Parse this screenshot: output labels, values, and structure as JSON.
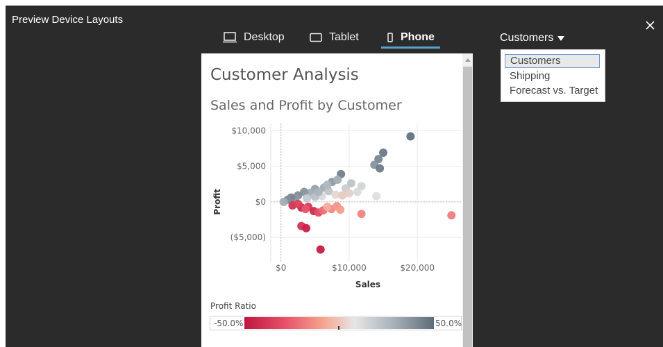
{
  "window": {
    "title": "Preview Device Layouts"
  },
  "device_tabs": [
    {
      "label": "Desktop",
      "icon": "monitor-icon",
      "active": false
    },
    {
      "label": "Tablet",
      "icon": "tablet-icon",
      "active": false
    },
    {
      "label": "Phone",
      "icon": "phone-icon",
      "active": true
    }
  ],
  "dashboard_selector": {
    "selected": "Customers",
    "options": [
      "Customers",
      "Shipping",
      "Forecast vs. Target"
    ]
  },
  "dashboard": {
    "title": "Customer Analysis",
    "subtitle": "Sales and Profit by Customer"
  },
  "legend": {
    "title": "Profit Ratio",
    "min": "-50.0%",
    "max": "50.0%"
  },
  "colors": {
    "accent": "#5aa0d0",
    "negative": "#c0163f",
    "positive": "#5d6c7a"
  },
  "chart_data": {
    "type": "scatter",
    "xlabel": "Sales",
    "ylabel": "Profit",
    "xlim": [
      -1500,
      26500
    ],
    "ylim": [
      -8500,
      11000
    ],
    "x_ticks": [
      {
        "v": 0,
        "label": "$0"
      },
      {
        "v": 10000,
        "label": "$10,000"
      },
      {
        "v": 20000,
        "label": "$20,000"
      }
    ],
    "y_ticks": [
      {
        "v": 10000,
        "label": "$10,000"
      },
      {
        "v": 5000,
        "label": "$5,000"
      },
      {
        "v": 0,
        "label": "$0"
      },
      {
        "v": -5000,
        "label": "($5,000)"
      }
    ],
    "grid": true,
    "points": [
      {
        "x": 19000,
        "y": 9200,
        "ratio": 0.48
      },
      {
        "x": 15000,
        "y": 6900,
        "ratio": 0.46
      },
      {
        "x": 14300,
        "y": 6000,
        "ratio": 0.42
      },
      {
        "x": 13700,
        "y": 5200,
        "ratio": 0.38
      },
      {
        "x": 14500,
        "y": 4700,
        "ratio": 0.45
      },
      {
        "x": 8800,
        "y": 3900,
        "ratio": 0.44
      },
      {
        "x": 7500,
        "y": 2800,
        "ratio": 0.36
      },
      {
        "x": 8300,
        "y": 3100,
        "ratio": 0.3
      },
      {
        "x": 10300,
        "y": 2600,
        "ratio": 0.2
      },
      {
        "x": 11800,
        "y": 2200,
        "ratio": 0.12
      },
      {
        "x": 11200,
        "y": 1400,
        "ratio": 0.1
      },
      {
        "x": 14000,
        "y": 800,
        "ratio": 0.08
      },
      {
        "x": 9500,
        "y": 1900,
        "ratio": 0.16
      },
      {
        "x": 6300,
        "y": 2000,
        "ratio": 0.3
      },
      {
        "x": 5000,
        "y": 1800,
        "ratio": 0.34
      },
      {
        "x": 4400,
        "y": 1300,
        "ratio": 0.3
      },
      {
        "x": 3400,
        "y": 1400,
        "ratio": 0.38
      },
      {
        "x": 2500,
        "y": 900,
        "ratio": 0.4
      },
      {
        "x": 2100,
        "y": 500,
        "ratio": 0.36
      },
      {
        "x": 1500,
        "y": 600,
        "ratio": 0.42
      },
      {
        "x": 1000,
        "y": 300,
        "ratio": 0.4
      },
      {
        "x": 400,
        "y": 0,
        "ratio": 0.3
      },
      {
        "x": 7000,
        "y": 1500,
        "ratio": 0.2
      },
      {
        "x": 8000,
        "y": 1000,
        "ratio": 0.06
      },
      {
        "x": 9000,
        "y": 900,
        "ratio": 0.02
      },
      {
        "x": 6000,
        "y": 800,
        "ratio": 0.1
      },
      {
        "x": 5000,
        "y": 700,
        "ratio": 0.22
      },
      {
        "x": 3800,
        "y": 500,
        "ratio": 0.18
      },
      {
        "x": 5500,
        "y": 1400,
        "ratio": 0.28
      },
      {
        "x": 6800,
        "y": 2400,
        "ratio": 0.26
      },
      {
        "x": 10000,
        "y": 1200,
        "ratio": 0.04
      },
      {
        "x": 3000,
        "y": -800,
        "ratio": -0.45
      },
      {
        "x": 1700,
        "y": -500,
        "ratio": -0.4
      },
      {
        "x": 2500,
        "y": -300,
        "ratio": -0.35
      },
      {
        "x": 4000,
        "y": -700,
        "ratio": -0.38
      },
      {
        "x": 4800,
        "y": -1300,
        "ratio": -0.42
      },
      {
        "x": 5500,
        "y": -1500,
        "ratio": -0.3
      },
      {
        "x": 6200,
        "y": -1200,
        "ratio": -0.22
      },
      {
        "x": 7400,
        "y": -1000,
        "ratio": -0.15
      },
      {
        "x": 8200,
        "y": -600,
        "ratio": -0.12
      },
      {
        "x": 8700,
        "y": -1100,
        "ratio": -0.1
      },
      {
        "x": 11800,
        "y": -1700,
        "ratio": -0.16
      },
      {
        "x": 25000,
        "y": -1900,
        "ratio": -0.18
      },
      {
        "x": 3600,
        "y": -1000,
        "ratio": -0.28
      },
      {
        "x": 6800,
        "y": -700,
        "ratio": -0.06
      },
      {
        "x": 3000,
        "y": -3400,
        "ratio": -0.4
      },
      {
        "x": 3700,
        "y": -3700,
        "ratio": -0.46
      },
      {
        "x": 5800,
        "y": -6700,
        "ratio": -0.48
      }
    ]
  }
}
